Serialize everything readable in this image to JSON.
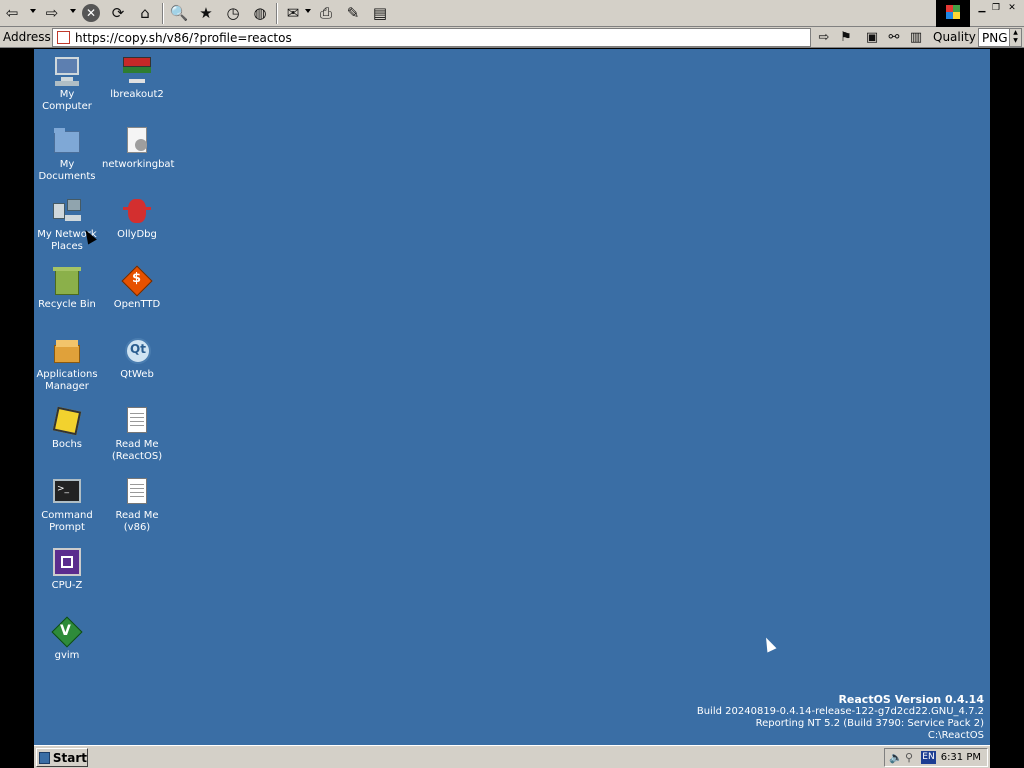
{
  "browser": {
    "address_label": "Address",
    "url": "https://copy.sh/v86/?profile=reactos",
    "quality_label": "Quality",
    "format_value": "PNG"
  },
  "desktop": {
    "icons_left": [
      {
        "label": "My\nComputer"
      },
      {
        "label": "My\nDocuments"
      },
      {
        "label": "My Network\nPlaces"
      },
      {
        "label": "Recycle Bin"
      },
      {
        "label": "Applications\nManager"
      },
      {
        "label": "Bochs"
      },
      {
        "label": "Command\nPrompt"
      },
      {
        "label": "CPU-Z"
      },
      {
        "label": "gvim"
      }
    ],
    "icons_right": [
      {
        "label": "lbreakout2"
      },
      {
        "label": "networkingbat"
      },
      {
        "label": "OllyDbg"
      },
      {
        "label": "OpenTTD"
      },
      {
        "label": "QtWeb"
      },
      {
        "label": "Read Me\n(ReactOS)"
      },
      {
        "label": "Read Me\n(v86)"
      }
    ],
    "version": {
      "title": "ReactOS Version 0.4.14",
      "build": "Build 20240819-0.4.14-release-122-g7d2cd22.GNU_4.7.2",
      "reporting": "Reporting NT 5.2 (Build 3790: Service Pack 2)",
      "path": "C:\\ReactOS"
    }
  },
  "taskbar": {
    "start_label": "Start",
    "language": "EN",
    "clock": "6:31 PM"
  }
}
